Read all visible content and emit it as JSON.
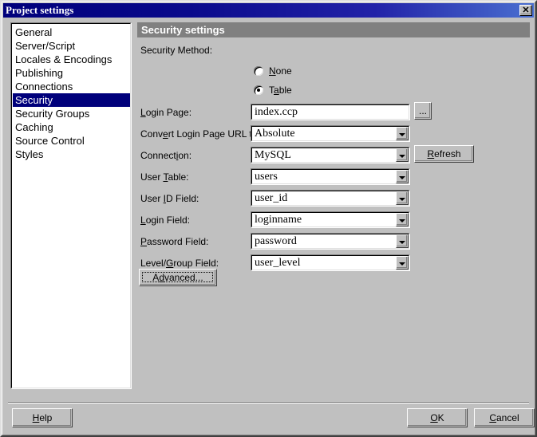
{
  "window": {
    "title": "Project settings",
    "close_glyph": "✕"
  },
  "sidebar": {
    "items": [
      {
        "label": "General",
        "selected": false
      },
      {
        "label": "Server/Script",
        "selected": false
      },
      {
        "label": "Locales & Encodings",
        "selected": false
      },
      {
        "label": "Publishing",
        "selected": false
      },
      {
        "label": "Connections",
        "selected": false
      },
      {
        "label": "Security",
        "selected": true
      },
      {
        "label": "Security Groups",
        "selected": false
      },
      {
        "label": "Caching",
        "selected": false
      },
      {
        "label": "Source Control",
        "selected": false
      },
      {
        "label": "Styles",
        "selected": false
      }
    ]
  },
  "panel": {
    "header": "Security settings",
    "security_method": {
      "label": "Security Method:",
      "options": [
        {
          "label": "None",
          "accel": "N",
          "checked": false
        },
        {
          "label": "Table",
          "accel": "a",
          "checked": true
        }
      ]
    },
    "fields": [
      {
        "label": "Login Page:",
        "accel_index": 0,
        "value": "index.ccp",
        "type": "text"
      },
      {
        "label": "Convert Login Page URL to:",
        "accel_index": 4,
        "value": "Absolute",
        "type": "combo"
      },
      {
        "label": "Connection:",
        "accel_index": 7,
        "value": "MySQL",
        "type": "combo"
      },
      {
        "label": "User Table:",
        "accel_index": 5,
        "value": "users",
        "type": "combo"
      },
      {
        "label": "User ID Field:",
        "accel_index": 5,
        "value": "user_id",
        "type": "combo"
      },
      {
        "label": "Login Field:",
        "accel_index": 0,
        "value": "loginname",
        "type": "combo"
      },
      {
        "label": "Password Field:",
        "accel_index": 0,
        "value": "password",
        "type": "combo"
      },
      {
        "label": "Level/Group Field:",
        "accel_index": 6,
        "value": "user_level",
        "type": "combo"
      }
    ],
    "browse_button": "...",
    "refresh_button": {
      "before": "R",
      "accel": "e",
      "after": "fresh"
    },
    "advanced_button": {
      "before": "A",
      "accel": "d",
      "after": "vanced..."
    }
  },
  "footer": {
    "help": {
      "before": "H",
      "accel": "e",
      "after": "lp"
    },
    "ok": {
      "before": "O",
      "accel": "K",
      "after": ""
    },
    "cancel": {
      "before": "",
      "accel": "C",
      "after": "ancel"
    }
  },
  "colors": {
    "face": "#c0c0c0",
    "title_start": "#00007b",
    "title_end": "#4a6fd0",
    "selection": "#00007b",
    "header_bar": "#808080",
    "field_bg": "#ffffff"
  }
}
